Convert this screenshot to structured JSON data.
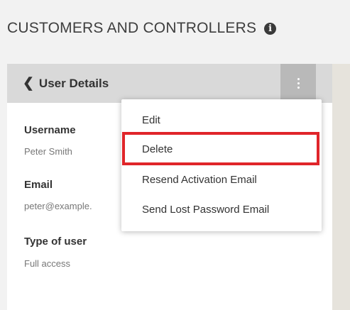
{
  "header": {
    "title": "CUSTOMERS AND CONTROLLERS",
    "info_icon_glyph": "i"
  },
  "panel": {
    "back_label": "User Details",
    "back_icon": "chevron-left-icon",
    "menu_icon": "kebab-menu-icon"
  },
  "fields": {
    "username_label": "Username",
    "username_value": "Peter Smith",
    "email_label": "Email",
    "email_value": "peter@example.",
    "type_label": "Type of user",
    "type_value": "Full access"
  },
  "menu": {
    "items": [
      "Edit",
      "Delete",
      "Resend Activation Email",
      "Send Lost Password Email"
    ],
    "highlighted_item": "Delete"
  },
  "colors": {
    "highlight": "#e0252a",
    "header_bg": "#d9d9d9",
    "menu_button_bg": "#b9b9b9"
  }
}
